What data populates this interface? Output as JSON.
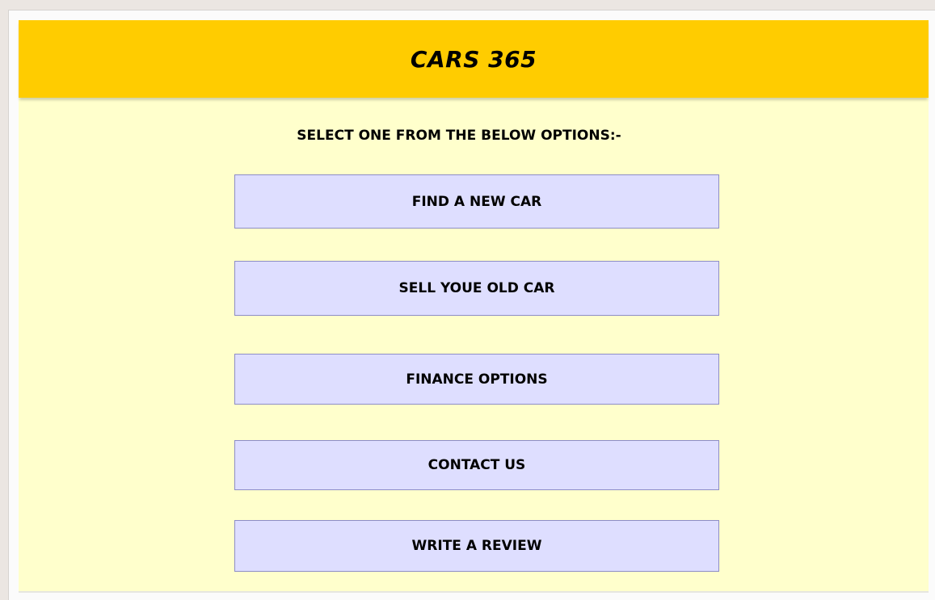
{
  "header": {
    "title": "CARS 365",
    "bg_color": "#ffcc00"
  },
  "main": {
    "prompt": "SELECT ONE FROM THE BELOW OPTIONS:-",
    "bg_color": "#ffffcc",
    "options": [
      {
        "label": "FIND A NEW CAR"
      },
      {
        "label": "SELL YOUE OLD CAR"
      },
      {
        "label": "FINANCE OPTIONS"
      },
      {
        "label": "CONTACT US"
      },
      {
        "label": "WRITE A REVIEW"
      }
    ],
    "button_color": "#dedeff",
    "button_border_color": "#8d8dc7"
  }
}
